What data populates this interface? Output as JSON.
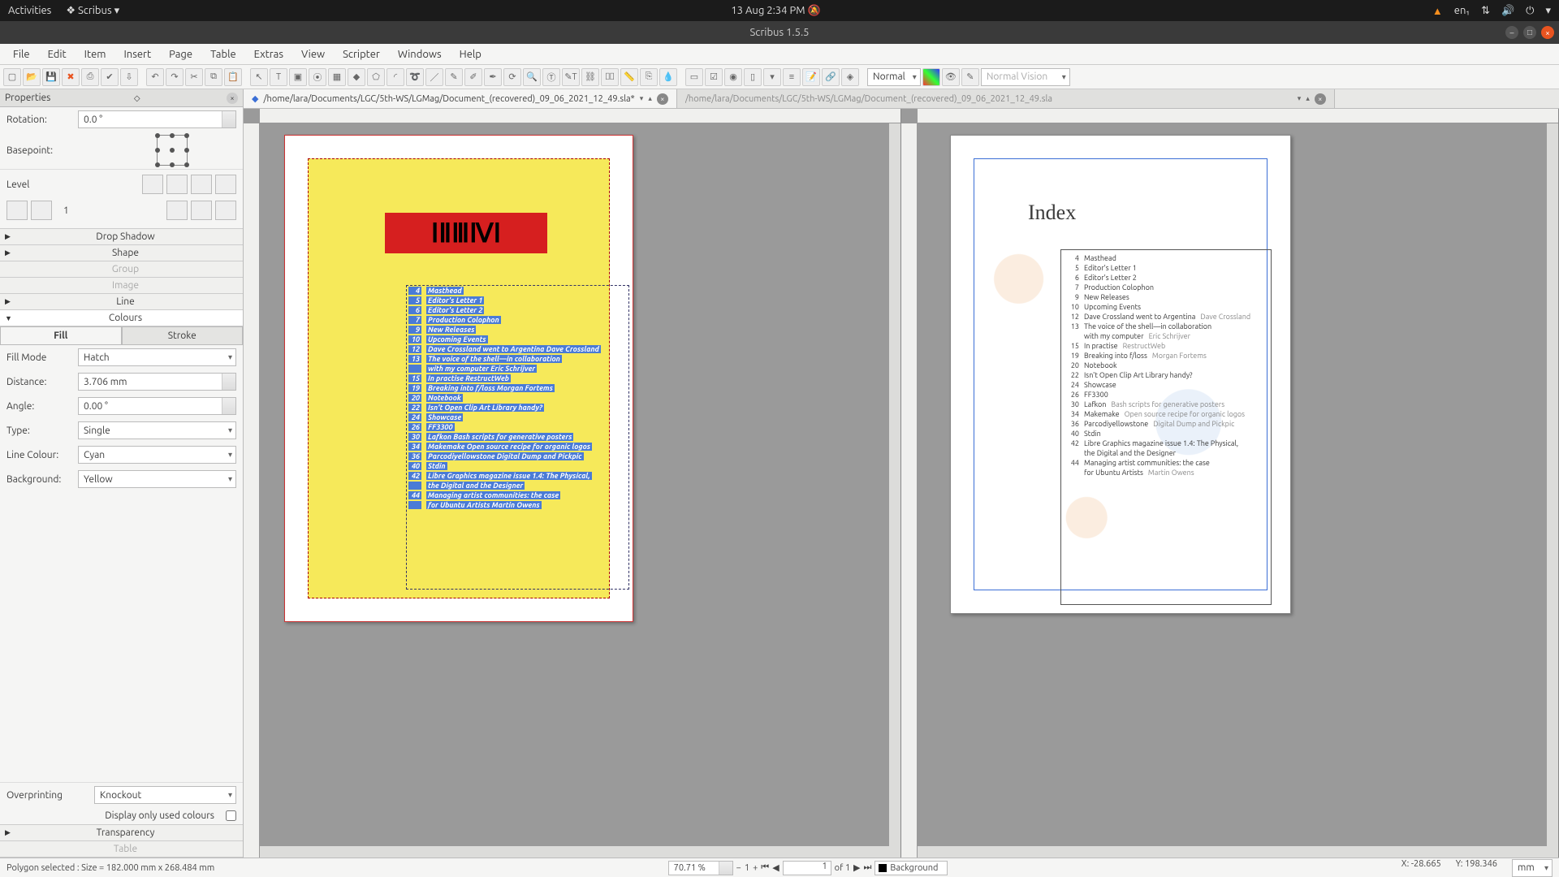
{
  "sysbar": {
    "activities": "Activities",
    "app": "Scribus",
    "clock": "13 Aug  2:34 PM",
    "lang": "en₁"
  },
  "titlebar": {
    "title": "Scribus 1.5.5"
  },
  "menu": [
    "File",
    "Edit",
    "Item",
    "Insert",
    "Page",
    "Table",
    "Extras",
    "View",
    "Scripter",
    "Windows",
    "Help"
  ],
  "toolbar_preview": "Normal",
  "toolbar_vision": "Normal Vision",
  "docs": {
    "active_path": "/home/lara/Documents/LGC/5th-WS/LGMag/Document_(recovered)_09_06_2021_12_49.sla*",
    "inactive_path": "/home/lara/Documents/LGC/5th-WS/LGMag/Document_(recovered)_09_06_2021_12_49.sla"
  },
  "props": {
    "title": "Properties",
    "rotation_label": "Rotation:",
    "rotation_value": "0.0 °",
    "basepoint_label": "Basepoint:",
    "level_label": "Level",
    "level_value": "1",
    "sections": {
      "drop_shadow": "Drop Shadow",
      "shape": "Shape",
      "group": "Group",
      "image": "Image",
      "line": "Line",
      "colours": "Colours",
      "transparency": "Transparency",
      "table": "Table"
    },
    "tabs": {
      "fill": "Fill",
      "stroke": "Stroke"
    },
    "fill_mode_label": "Fill Mode",
    "fill_mode_value": "Hatch",
    "distance_label": "Distance:",
    "distance_value": "3.706 mm",
    "angle_label": "Angle:",
    "angle_value": "0.00 °",
    "type_label": "Type:",
    "type_value": "Single",
    "line_colour_label": "Line Colour:",
    "line_colour_value": "Cyan",
    "background_label": "Background:",
    "background_value": "Yellow",
    "overprint_label": "Overprinting",
    "overprint_value": "Knockout",
    "display_used": "Display only used colours"
  },
  "left_page": {
    "redbar_text": "ⅠⅡⅢⅣⅠ",
    "index_rows": [
      {
        "pg": "4",
        "txt": "Masthead"
      },
      {
        "pg": "5",
        "txt": "Editor's Letter 1"
      },
      {
        "pg": "6",
        "txt": "Editor's Letter 2"
      },
      {
        "pg": "7",
        "txt": "Production Colophon"
      },
      {
        "pg": "9",
        "txt": "New Releases"
      },
      {
        "pg": "10",
        "txt": "Upcoming Events"
      },
      {
        "pg": "12",
        "txt": "Dave Crossland went to Argentina Dave Crossland"
      },
      {
        "pg": "13",
        "txt": "The voice of the shell—in collaboration"
      },
      {
        "pg": "",
        "txt": "with my computer Eric Schrijver"
      },
      {
        "pg": "15",
        "txt": "In practise RestructWeb"
      },
      {
        "pg": "19",
        "txt": "Breaking into f/loss Morgan Fortems"
      },
      {
        "pg": "20",
        "txt": "Notebook"
      },
      {
        "pg": "22",
        "txt": "Isn't Open Clip Art Library handy?"
      },
      {
        "pg": "24",
        "txt": "Showcase"
      },
      {
        "pg": "26",
        "txt": "FF3300"
      },
      {
        "pg": "30",
        "txt": "Lafkon Bash scripts for generative posters"
      },
      {
        "pg": "34",
        "txt": "Makemake Open source recipe for organic logos"
      },
      {
        "pg": "36",
        "txt": "Parcodiyellowstone Digital Dump and Pickpic"
      },
      {
        "pg": "40",
        "txt": "Stdin"
      },
      {
        "pg": "42",
        "txt": "Libre Graphics magazine issue 1.4: The Physical,"
      },
      {
        "pg": "",
        "txt": "the Digital and the Designer"
      },
      {
        "pg": "44",
        "txt": "Managing artist communities: the case"
      },
      {
        "pg": "",
        "txt": "for Ubuntu Artists Martin Owens"
      }
    ]
  },
  "right_page": {
    "title": "Index",
    "index_rows": [
      {
        "pg": "4",
        "txt": "Masthead",
        "auth": ""
      },
      {
        "pg": "5",
        "txt": "Editor's Letter 1",
        "auth": ""
      },
      {
        "pg": "6",
        "txt": "Editor's Letter 2",
        "auth": ""
      },
      {
        "pg": "7",
        "txt": "Production Colophon",
        "auth": ""
      },
      {
        "pg": "9",
        "txt": "New Releases",
        "auth": ""
      },
      {
        "pg": "10",
        "txt": "Upcoming Events",
        "auth": ""
      },
      {
        "pg": "12",
        "txt": "Dave Crossland went to Argentina",
        "auth": "Dave Crossland"
      },
      {
        "pg": "13",
        "txt": "The voice of the shell—in collaboration",
        "auth": ""
      },
      {
        "pg": "",
        "txt": "with my computer",
        "auth": "Eric Schrijver"
      },
      {
        "pg": "15",
        "txt": "In practise",
        "auth": "RestructWeb"
      },
      {
        "pg": "19",
        "txt": "Breaking into f/loss",
        "auth": "Morgan Fortems"
      },
      {
        "pg": "20",
        "txt": "Notebook",
        "auth": ""
      },
      {
        "pg": "22",
        "txt": "Isn't Open Clip Art Library handy?",
        "auth": ""
      },
      {
        "pg": "24",
        "txt": "Showcase",
        "auth": ""
      },
      {
        "pg": "26",
        "txt": "FF3300",
        "auth": ""
      },
      {
        "pg": "30",
        "txt": "Lafkon",
        "auth": "Bash scripts for generative posters"
      },
      {
        "pg": "34",
        "txt": "Makemake",
        "auth": "Open source recipe for organic logos"
      },
      {
        "pg": "36",
        "txt": "Parcodiyellowstone",
        "auth": "Digital Dump and Pickpic"
      },
      {
        "pg": "40",
        "txt": "Stdin",
        "auth": ""
      },
      {
        "pg": "42",
        "txt": "Libre Graphics magazine issue 1.4: The Physical,",
        "auth": ""
      },
      {
        "pg": "",
        "txt": "the Digital and the Designer",
        "auth": ""
      },
      {
        "pg": "44",
        "txt": "Managing artist communities: the case",
        "auth": ""
      },
      {
        "pg": "",
        "txt": "for Ubuntu Artists",
        "auth": "Martin Owens"
      }
    ]
  },
  "status": {
    "selection": "Polygon selected : Size = 182.000 mm x 268.484 mm",
    "zoom": "70.71 %",
    "page": "1",
    "page_of": "of 1",
    "layer": "Background",
    "x_label": "X:",
    "x_val": "-28.665",
    "y_label": "Y:",
    "y_val": "198.346",
    "unit": "mm"
  }
}
